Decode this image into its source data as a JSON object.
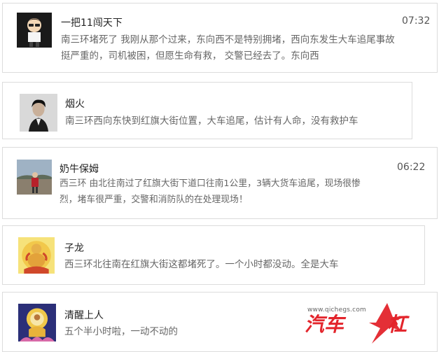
{
  "comments": [
    {
      "name": "一把11闯天下",
      "time": "07:32",
      "lines": [
        "南三环堵死了 我刚从那个过来，东向西不是特别拥堵，西向东发生大车追尾事故",
        "挺严重的，司机被困，但愿生命有救， 交警已经去了。东向西"
      ]
    },
    {
      "name": "烟火",
      "time": "",
      "lines": [
        "南三环西向东快到红旗大街位置，大车追尾，估计有人命，没有救护车"
      ]
    },
    {
      "name": "奶牛保姆",
      "time": "06:22",
      "lines": [
        "西三环 由北往南过了红旗大街下道口往南1公里，3辆大货车追尾，现场很惨",
        "烈，堵车很严重，交警和消防队的在处理现场！"
      ]
    },
    {
      "name": "子龙",
      "time": "",
      "lines": [
        "西三环北往南在红旗大街这都堵死了。一个小时都没动。全是大车"
      ]
    },
    {
      "name": "清醒上人",
      "time": "",
      "lines": [
        "五个半小时啦，一动不动的"
      ]
    }
  ],
  "watermark": {
    "url": "www.qichegs.com",
    "logo_text": "汽车杠",
    "color": "#e3242b"
  }
}
